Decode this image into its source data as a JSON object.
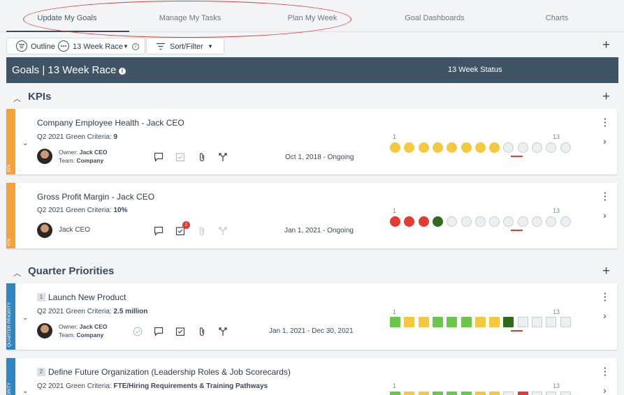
{
  "tabs": [
    {
      "label": "Update My Goals",
      "active": true
    },
    {
      "label": "Manage My Tasks",
      "active": false
    },
    {
      "label": "Plan My Week",
      "active": false
    },
    {
      "label": "Goal Dashboards",
      "active": false
    },
    {
      "label": "Charts",
      "active": false
    }
  ],
  "toolbar": {
    "outline_label": "Outline",
    "view_select": "13 Week Race",
    "sort_filter_label": "Sort/Filter"
  },
  "header": {
    "title": "Goals | 13 Week Race",
    "status_label": "13 Week Status"
  },
  "colors": {
    "kpi": "#f5a13d",
    "priority": "#2f86c5",
    "yellow": "#f5c842",
    "red": "#e03c31",
    "dark_green": "#2e6b1f",
    "green": "#6ac74a",
    "empty": "#eeeff1"
  },
  "sections": [
    {
      "title": "KPIs",
      "items": [
        {
          "tag": "KPI",
          "title": "Company Employee Health - Jack CEO",
          "criteria_label": "Q2 2021 Green Criteria:",
          "criteria_value": "9",
          "owner_label": "Owner:",
          "owner": "Jack CEO",
          "team_label": "Team:",
          "team": "Company",
          "date": "Oct 1, 2018 - Ongoing",
          "range_start": "1",
          "range_end": "13",
          "weeks": [
            "yellow",
            "yellow",
            "yellow",
            "yellow",
            "yellow",
            "yellow",
            "yellow",
            "yellow",
            "empty",
            "empty",
            "empty",
            "empty",
            "empty"
          ],
          "current_week": 9,
          "shape": "circle"
        },
        {
          "tag": "KPI",
          "title": "Gross Profit Margin - Jack CEO",
          "criteria_label": "Q2 2021 Green Criteria:",
          "criteria_value": "10%",
          "owner_name": "Jack CEO",
          "task_badge": "2",
          "date": "Jan 1, 2021 - Ongoing",
          "range_start": "1",
          "range_end": "13",
          "weeks": [
            "red",
            "red",
            "red",
            "dark_green",
            "empty",
            "empty",
            "empty",
            "empty",
            "empty",
            "empty",
            "empty",
            "empty",
            "empty"
          ],
          "current_week": 9,
          "shape": "circle"
        }
      ]
    },
    {
      "title": "Quarter Priorities",
      "items": [
        {
          "tag": "QUARTER PRIORITY",
          "number": "1",
          "title": "Launch New Product",
          "criteria_label": "Q2 2021 Green Criteria:",
          "criteria_value": "2.5 million",
          "owner_label": "Owner:",
          "owner": "Jack CEO",
          "team_label": "Team:",
          "team": "Company",
          "date": "Jan 1, 2021 - Dec 30, 2021",
          "range_start": "1",
          "range_end": "13",
          "weeks": [
            "green",
            "yellow",
            "yellow",
            "green",
            "green",
            "green",
            "yellow",
            "yellow",
            "dark_green",
            "empty",
            "empty",
            "empty",
            "empty"
          ],
          "current_week": 9,
          "shape": "square"
        },
        {
          "tag": "PRIORITY",
          "number": "2",
          "title": "Define Future Organization (Leadership Roles & Job Scorecards)",
          "criteria_label": "Q2 2021 Green Criteria:",
          "criteria_value": "FTE/Hiring Requirements & Training Pathways",
          "range_start": "1",
          "range_end": "13",
          "weeks": [
            "green",
            "yellow",
            "yellow",
            "green",
            "green",
            "green",
            "yellow",
            "yellow",
            "empty",
            "red",
            "empty",
            "empty",
            "empty"
          ],
          "current_week": 9,
          "shape": "square"
        }
      ]
    }
  ]
}
